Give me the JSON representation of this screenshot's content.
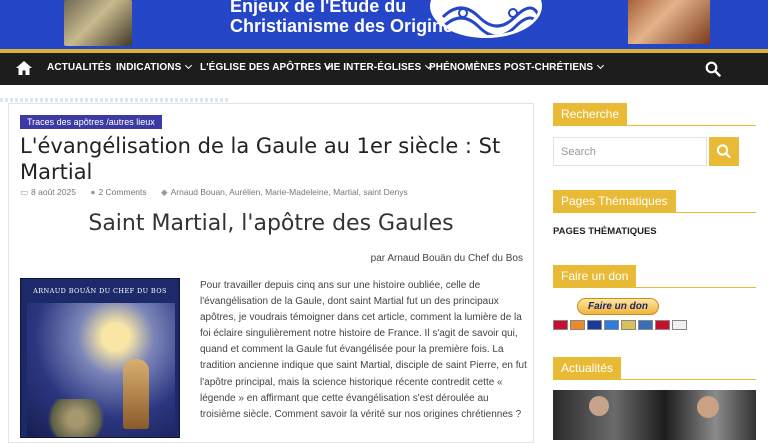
{
  "banner": {
    "title_line1": "Enjeux de l'Etude du",
    "title_line2": "Christianisme des Origines"
  },
  "nav": {
    "items": [
      {
        "label": "ACTUALITÉS",
        "has_dropdown": false
      },
      {
        "label": "INDICATIONS",
        "has_dropdown": true
      },
      {
        "label": "L'ÉGLISE DES APÔTRES",
        "has_dropdown": true
      },
      {
        "label": "VIE INTER-ÉGLISES",
        "has_dropdown": true
      },
      {
        "label": "PHÉNOMÈNES POST-CHRÉTIENS",
        "has_dropdown": true
      }
    ]
  },
  "article": {
    "category": "Traces des apôtres /autres lieux",
    "title": "L'évangélisation de la Gaule au 1er siècle : St Martial",
    "date": "8 août 2025",
    "comments": "2 Comments",
    "tags": "Arnaud Bouan, Aurélien, Marie-Madeleine, Martial, saint Denys",
    "subtitle": "Saint Martial, l'apôtre des Gaules",
    "byline": "par Arnaud Bouän du Chef du Bos",
    "book_author": "ARNAUD BOUÄN DU CHEF DU BOS",
    "body": "Pour travailler depuis cinq ans sur une histoire oubliée, celle de l'évangélisation de la Gaule, dont saint Martial fut un des principaux apôtres, je voudrais témoigner dans cet article, comment la lumière de la foi éclaire singulièrement notre histoire de France. Il s'agit de savoir qui, quand et comment la Gaule fut évangélisée pour la première fois. La tradition ancienne indique que saint Martial, disciple de saint Pierre, en fut l'apôtre principal, mais la science historique récente contredit cette « légende » en affirmant que cette évangélisation s'est déroulée au troisième siècle. Comment savoir la vérité sur nos origines chrétiennes ?"
  },
  "sidebar": {
    "search_title": "Recherche",
    "search_placeholder": "Search",
    "pages_title": "Pages Thématiques",
    "pages_label": "PAGES THÉMATIQUES",
    "donate_title": "Faire un don",
    "donate_button": "Faire un don",
    "news_title": "Actualités"
  },
  "colors": {
    "banner": "#2546c7",
    "nav": "#1d1d1d",
    "accent": "#e8ba36",
    "category": "#3c3aa3"
  }
}
